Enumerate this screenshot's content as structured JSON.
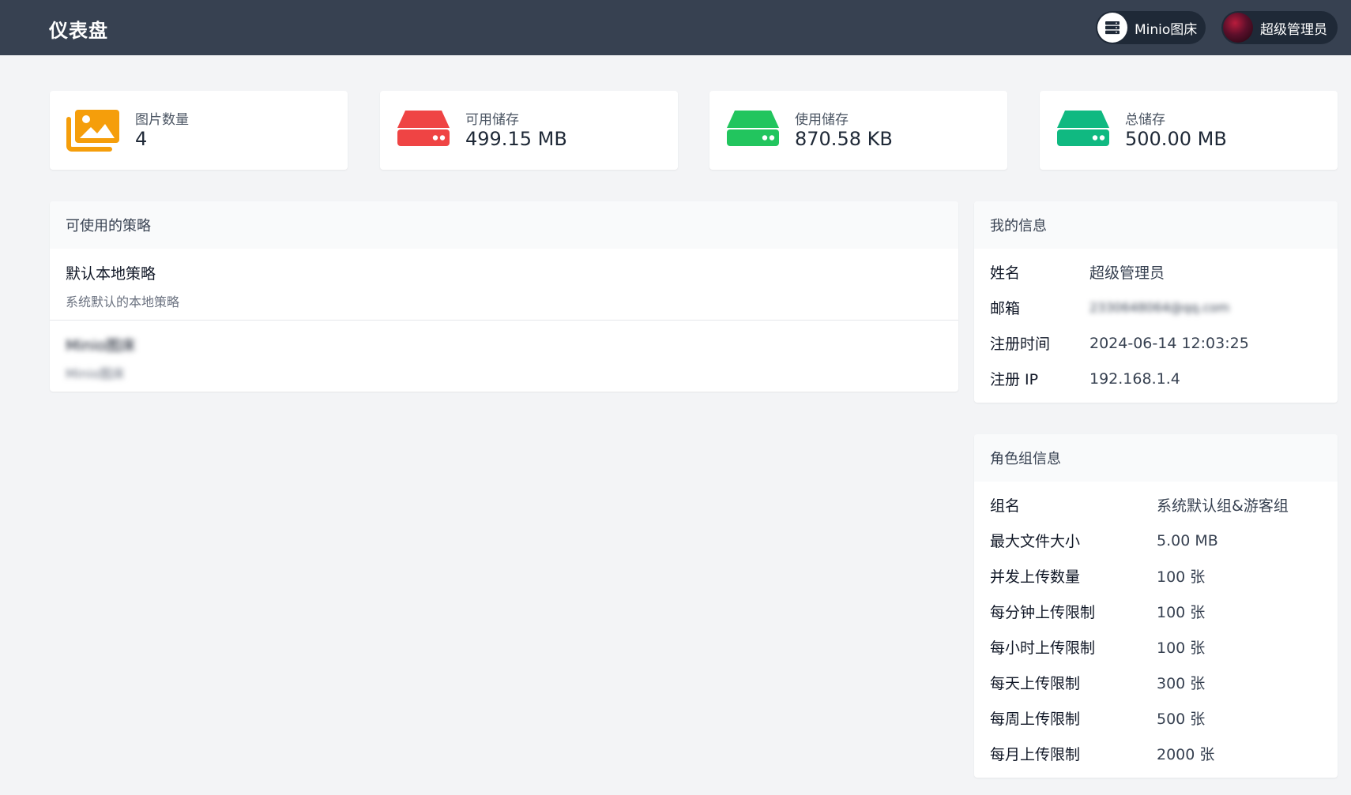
{
  "header": {
    "title": "仪表盘",
    "storage_label": "Minio图床",
    "user_label": "超级管理员"
  },
  "stats": [
    {
      "label": "图片数量",
      "value": "4",
      "icon": "images-icon",
      "color": "#f59e0b"
    },
    {
      "label": "可用储存",
      "value": "499.15 MB",
      "icon": "hard-drive-icon",
      "color": "#ef4444"
    },
    {
      "label": "使用储存",
      "value": "870.58 KB",
      "icon": "hard-drive-icon",
      "color": "#22c55e"
    },
    {
      "label": "总储存",
      "value": "500.00 MB",
      "icon": "hard-drive-icon",
      "color": "#10b981"
    }
  ],
  "policies": {
    "title": "可使用的策略",
    "items": [
      {
        "name": "默认本地策略",
        "desc": "系统默认的本地策略"
      },
      {
        "name": "Minio图床",
        "desc": "Minio图床"
      }
    ]
  },
  "my_info": {
    "title": "我的信息",
    "rows": [
      {
        "k": "姓名",
        "v": "超级管理员"
      },
      {
        "k": "邮箱",
        "v": "2330648064@qq.com"
      },
      {
        "k": "注册时间",
        "v": "2024-06-14 12:03:25"
      },
      {
        "k": "注册 IP",
        "v": "192.168.1.4"
      }
    ]
  },
  "role_info": {
    "title": "角色组信息",
    "rows": [
      {
        "k": "组名",
        "v": "系统默认组&游客组"
      },
      {
        "k": "最大文件大小",
        "v": "5.00 MB"
      },
      {
        "k": "并发上传数量",
        "v": "100 张"
      },
      {
        "k": "每分钟上传限制",
        "v": "100 张"
      },
      {
        "k": "每小时上传限制",
        "v": "100 张"
      },
      {
        "k": "每天上传限制",
        "v": "300 张"
      },
      {
        "k": "每周上传限制",
        "v": "500 张"
      },
      {
        "k": "每月上传限制",
        "v": "2000 张"
      }
    ]
  }
}
